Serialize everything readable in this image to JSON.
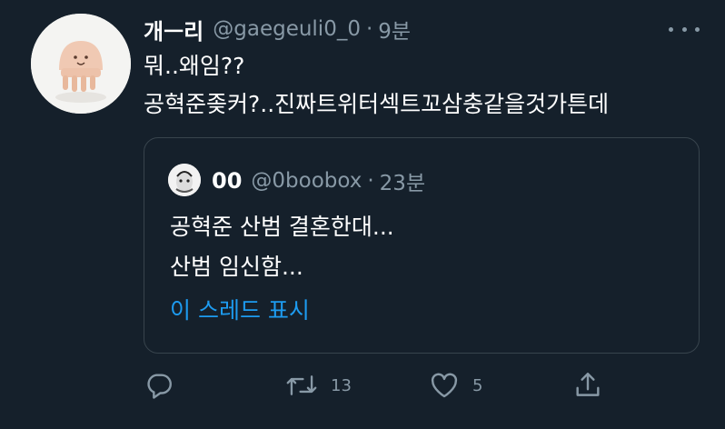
{
  "tweet": {
    "display_name": "개ㅡ리",
    "handle": "@gaegeuli0_0",
    "separator": "·",
    "time": "9분",
    "text_lines": [
      "뭐..왜임??",
      "공혁준좆커?..진짜트위터섹트꼬삼충같을것가튼데"
    ]
  },
  "quoted_tweet": {
    "display_name": "00",
    "handle": "@0boobox",
    "separator": "·",
    "time": "23분",
    "text_lines": [
      "공혁준 산범 결혼한대...",
      "산범 임신함..."
    ],
    "thread_link": "이 스레드 표시"
  },
  "actions": {
    "reply_icon": "reply-icon",
    "retweet_icon": "retweet-icon",
    "retweet_count": "13",
    "like_icon": "heart-icon",
    "like_count": "5",
    "share_icon": "share-icon"
  },
  "colors": {
    "background": "#15202b",
    "secondary_text": "#8899a6",
    "link": "#1d9bf0",
    "border": "#38444d"
  }
}
